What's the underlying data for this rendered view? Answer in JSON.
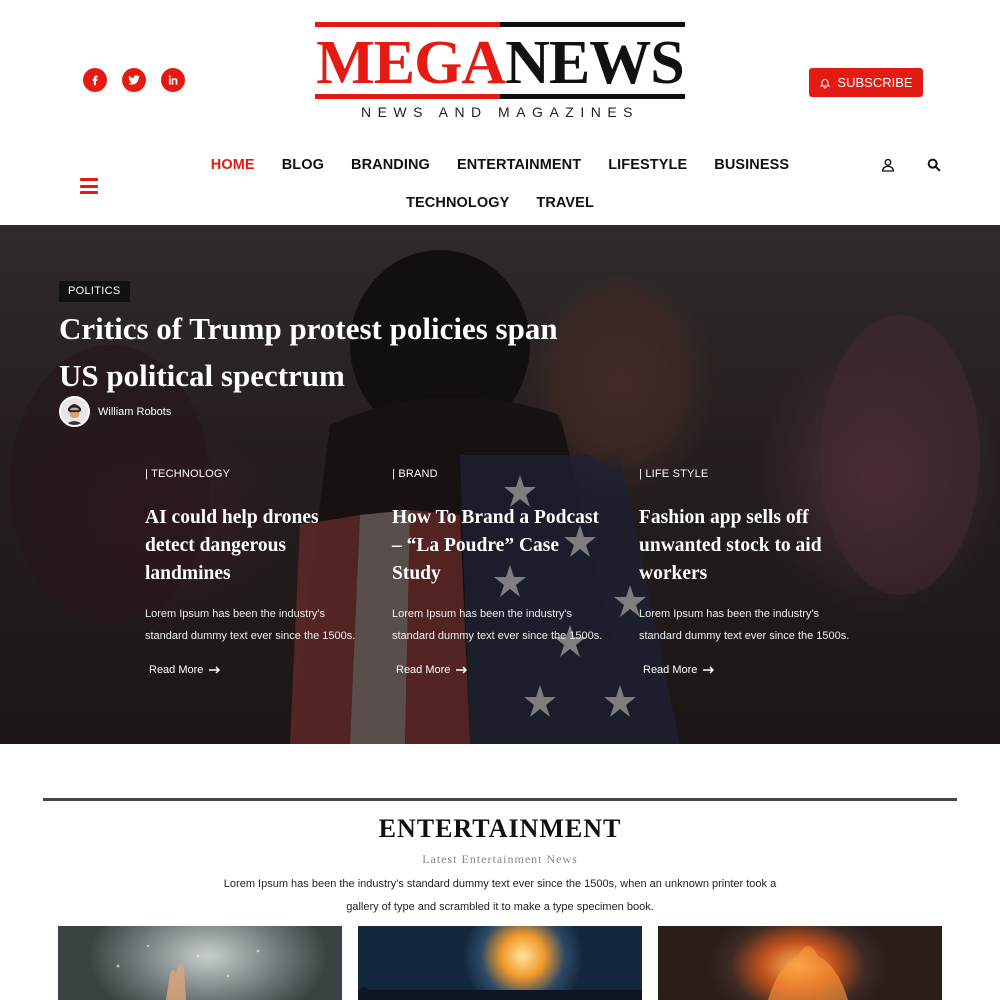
{
  "brand": {
    "name_part1": "MEGA",
    "name_part2": "NEWS",
    "tagline": "NEWS AND MAGAZINES",
    "accent_color": "#e31b13"
  },
  "header": {
    "socials": [
      {
        "icon": "facebook-icon"
      },
      {
        "icon": "twitter-icon"
      },
      {
        "icon": "linkedin-icon"
      }
    ],
    "subscribe_label": "SUBSCRIBE",
    "nav": [
      "HOME",
      "BLOG",
      "BRANDING",
      "ENTERTAINMENT",
      "LIFESTYLE",
      "BUSINESS",
      "TECHNOLOGY",
      "TRAVEL"
    ],
    "active_nav": "HOME",
    "icons": [
      "menu-icon",
      "user-icon",
      "search-icon"
    ]
  },
  "hero": {
    "category": "POLITICS",
    "title": "Critics of Trump protest policies span US political spectrum",
    "author": "William Robots",
    "cards": [
      {
        "category": "| TECHNOLOGY",
        "title": "AI could help drones detect dangerous landmines",
        "description": "Lorem Ipsum has been the industry's standard dummy text ever since the 1500s.",
        "read_more": "Read More"
      },
      {
        "category": "| BRAND",
        "title": "How To Brand a Podcast – “La Poudre” Case Study",
        "description": "Lorem Ipsum has been the industry's standard dummy text ever since the 1500s.",
        "read_more": "Read More"
      },
      {
        "category": "| LIFE STYLE",
        "title": "Fashion app sells off unwanted stock to aid workers",
        "description": "Lorem Ipsum has been the industry's standard dummy text ever since the 1500s.",
        "read_more": "Read More"
      }
    ]
  },
  "entertainment": {
    "title": "ENTERTAINMENT",
    "subtitle": "Latest Entertainment News",
    "description": "Lorem Ipsum has been the industry's standard dummy text ever since the 1500s, when an unknown printer took a gallery of type and scrambled it to make a type specimen book."
  }
}
